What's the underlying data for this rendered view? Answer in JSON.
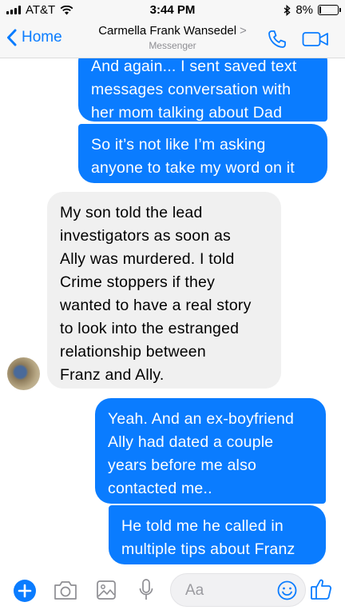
{
  "status_bar": {
    "carrier": "AT&T",
    "time": "3:44 PM",
    "battery_percent": "8%",
    "battery_level": 0.08
  },
  "header": {
    "back_label": "Home",
    "contact_name": "Carmella Frank Wansedel",
    "contact_chevron": ">",
    "subtitle": "Messenger"
  },
  "messages": [
    {
      "id": "m1",
      "direction": "outgoing",
      "lines": [
        "And again... I sent saved text",
        "messages conversation with",
        "her mom talking about Dad"
      ]
    },
    {
      "id": "m2",
      "direction": "outgoing",
      "lines": [
        "So it’s not like I’m asking",
        "anyone to take my word on it"
      ]
    },
    {
      "id": "m3",
      "direction": "incoming",
      "lines": [
        "My son told the lead",
        "investigators as soon as",
        "Ally was murdered. I told",
        "Crime stoppers if they",
        "wanted to have a real story",
        "to look into the estranged",
        "relationship between",
        "Franz and Ally."
      ]
    },
    {
      "id": "m4",
      "direction": "outgoing",
      "lines": [
        "Yeah. And an ex-boyfriend",
        "Ally had dated a couple",
        "years before me also",
        "contacted me.."
      ]
    },
    {
      "id": "m5",
      "direction": "outgoing",
      "lines": [
        "He told me he called in",
        "multiple tips about Franz"
      ]
    }
  ],
  "composer": {
    "placeholder": "Aa"
  },
  "colors": {
    "accent": "#0a7cff",
    "incoming_bubble": "#f0f0f0",
    "bar_background": "#f7f7f7"
  },
  "icons": [
    "signal-icon",
    "wifi-icon",
    "bluetooth-icon",
    "battery-icon",
    "back-chevron-icon",
    "phone-icon",
    "video-camera-icon",
    "plus-icon",
    "camera-icon",
    "image-icon",
    "microphone-icon",
    "emoji-icon",
    "thumbs-up-icon"
  ]
}
